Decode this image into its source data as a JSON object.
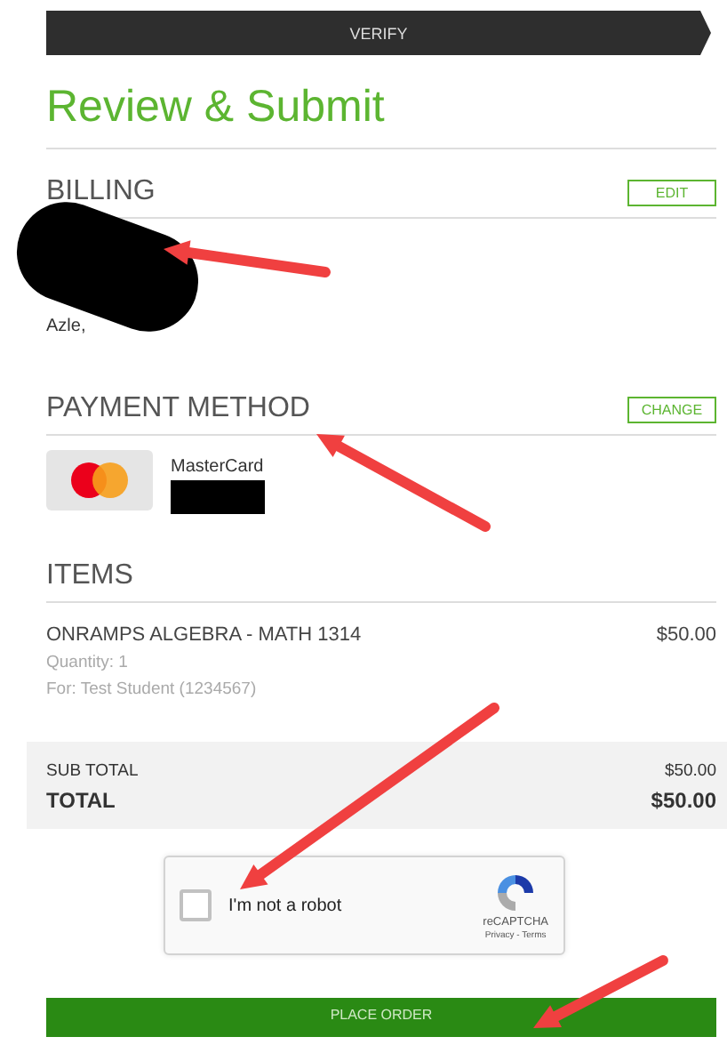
{
  "progress_step": {
    "label": "VERIFY"
  },
  "title": "Review & Submit",
  "billing": {
    "heading": "BILLING",
    "button": "EDIT",
    "address_lines": [
      "Azle,"
    ]
  },
  "payment": {
    "heading": "PAYMENT METHOD",
    "button": "CHANGE",
    "card_brand": "MasterCard"
  },
  "items": {
    "heading": "ITEMS",
    "list": [
      {
        "name": "ONRAMPS ALGEBRA - MATH 1314",
        "price": "$50.00",
        "quantity": "Quantity: 1",
        "for": "For: Test Student (1234567)"
      }
    ]
  },
  "totals": [
    {
      "label": "SUB TOTAL",
      "amount": "$50.00",
      "kind": "sub"
    },
    {
      "label": "TOTAL",
      "amount": "$50.00",
      "kind": "grand"
    }
  ],
  "captcha": {
    "label": "I'm not a robot",
    "checked": false,
    "brand": "reCAPTCHA",
    "links": "Privacy - Terms"
  },
  "place_order": {
    "label": "PLACE ORDER"
  }
}
